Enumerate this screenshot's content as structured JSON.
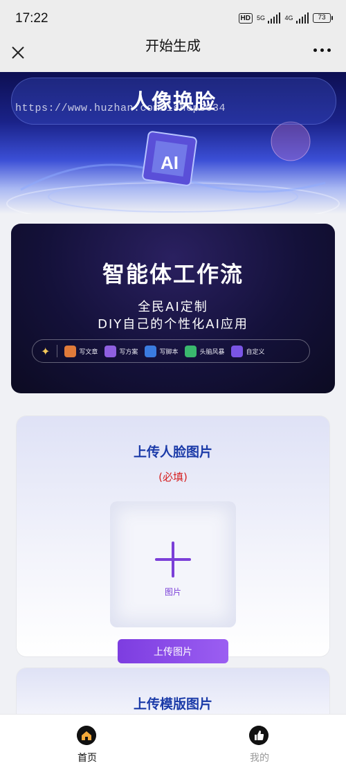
{
  "status_bar": {
    "time": "17:22",
    "hd": "HD",
    "net1": "5G",
    "net2": "4G",
    "battery": "73"
  },
  "nav": {
    "title": "开始生成"
  },
  "hero": {
    "title": "人像换脸",
    "watermark": "https://www.huzhan.com/ishop3034"
  },
  "banner": {
    "title": "智能体工作流",
    "line1": "全民AI定制",
    "line2": "DIY自己的个性化AI应用",
    "chips": [
      {
        "label": "写文章",
        "color": "#e07a3a"
      },
      {
        "label": "写方案",
        "color": "#8e5fe0"
      },
      {
        "label": "写脚本",
        "color": "#3a7be0"
      },
      {
        "label": "头脑风暴",
        "color": "#3ab86e"
      },
      {
        "label": "自定义",
        "color": "#7a55e6"
      }
    ]
  },
  "upload_face": {
    "title": "上传人脸图片",
    "required": "(必填)",
    "placeholder_label": "图片",
    "button": "上传图片"
  },
  "upload_template": {
    "title": "上传模版图片"
  },
  "tabbar": {
    "home": "首页",
    "mine": "我的",
    "active_color": "#111111",
    "inactive_color": "#999999"
  }
}
